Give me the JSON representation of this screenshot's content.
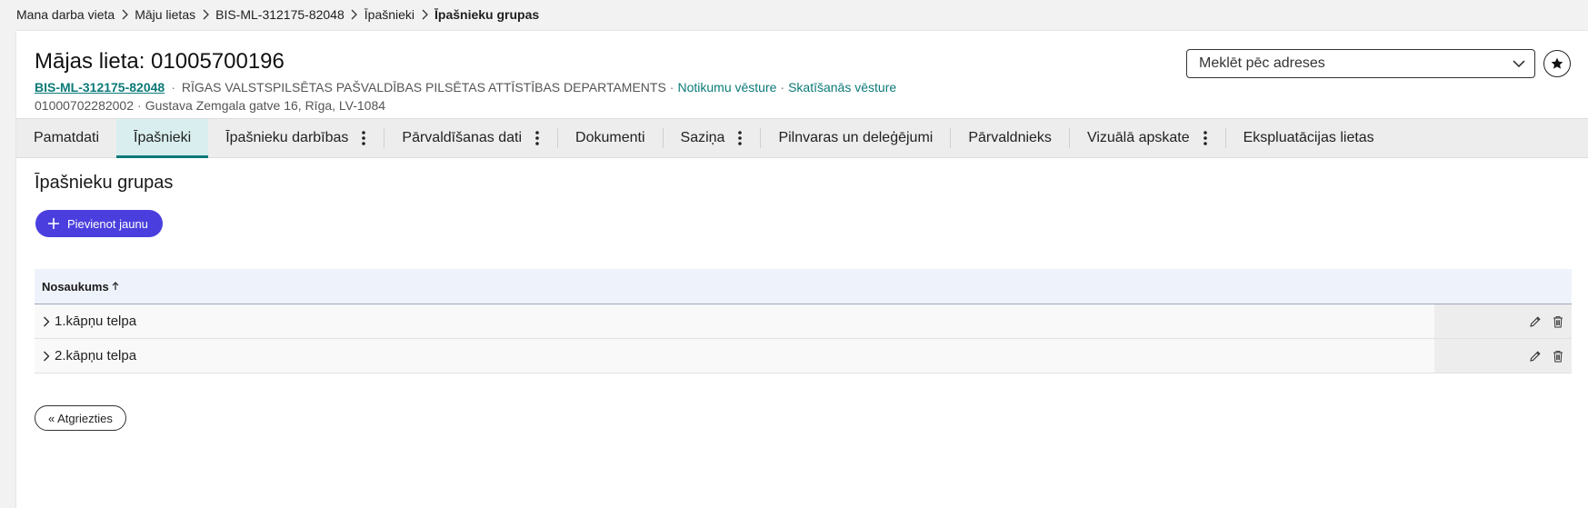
{
  "breadcrumb": [
    {
      "label": "Mana darba vieta"
    },
    {
      "label": "Māju lietas"
    },
    {
      "label": "BIS-ML-312175-82048"
    },
    {
      "label": "Īpašnieki"
    },
    {
      "label": "Īpašnieku grupas"
    }
  ],
  "header": {
    "title": "Mājas lieta: 01005700196",
    "case_code": "BIS-ML-312175-82048",
    "department": "RĪGAS VALSTSPILSĒTAS PAŠVALDĪBAS PILSĒTAS ATTĪSTĪBAS DEPARTAMENTS",
    "events_link": "Notikumu vēsture",
    "views_link": "Skatīšanās vēsture",
    "cadastre": "01000702282002",
    "address": "Gustava Zemgala gatve 16, Rīga, LV-1084",
    "separator": "·"
  },
  "search": {
    "placeholder": "Meklēt pēc adreses",
    "icon": "chevron-down-icon"
  },
  "favorite": {
    "icon": "star-icon"
  },
  "tabs": [
    {
      "label": "Pamatdati",
      "active": false,
      "menu": false
    },
    {
      "label": "Īpašnieki",
      "active": true,
      "menu": false
    },
    {
      "label": "Īpašnieku darbības",
      "active": false,
      "menu": true
    },
    {
      "label": "Pārvaldīšanas dati",
      "active": false,
      "menu": true
    },
    {
      "label": "Dokumenti",
      "active": false,
      "menu": false
    },
    {
      "label": "Saziņa",
      "active": false,
      "menu": true
    },
    {
      "label": "Pilnvaras un deleģējumi",
      "active": false,
      "menu": false
    },
    {
      "label": "Pārvaldnieks",
      "active": false,
      "menu": false
    },
    {
      "label": "Vizuālā apskate",
      "active": false,
      "menu": true
    },
    {
      "label": "Ekspluatācijas lietas",
      "active": false,
      "menu": false
    }
  ],
  "main": {
    "section_title": "Īpašnieku grupas",
    "add_button": "Pievienot jaunu",
    "table": {
      "columns": [
        {
          "label": "Nosaukums",
          "sort": "asc"
        }
      ],
      "rows": [
        {
          "name": "1.kāpņu telpa"
        },
        {
          "name": "2.kāpņu telpa"
        }
      ]
    },
    "back_button": "« Atgriezties"
  },
  "colors": {
    "accent": "#0b7a78",
    "primary_button": "#4a3fde",
    "active_tab_bg": "#d9efef",
    "table_header_bg": "#eef3fb"
  }
}
